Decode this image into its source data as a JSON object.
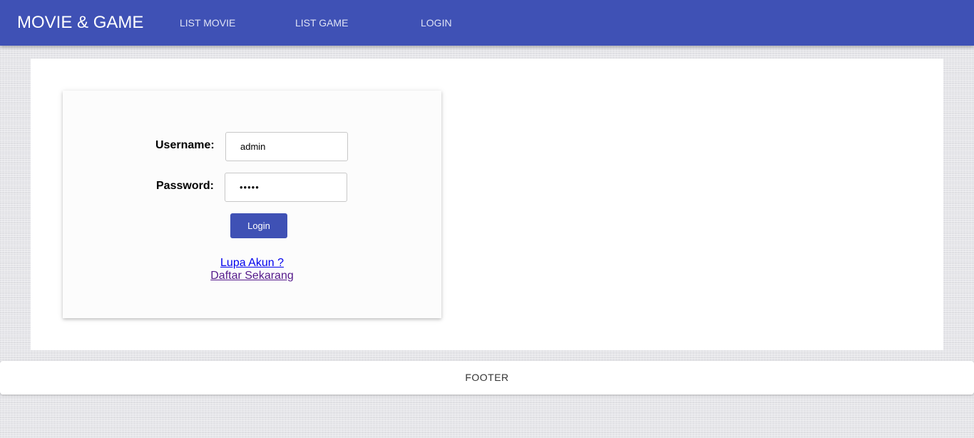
{
  "navbar": {
    "brand": "MOVIE & GAME",
    "links": [
      {
        "label": "LIST MOVIE"
      },
      {
        "label": "LIST GAME"
      },
      {
        "label": "LOGIN"
      }
    ],
    "color": "#3f51b5"
  },
  "login_form": {
    "username_label": "Username:",
    "username_value": "admin",
    "password_label": "Password:",
    "password_value": "admin",
    "submit_label": "Login",
    "forgot_link": "Lupa Akun ?",
    "register_link": "Daftar Sekarang"
  },
  "footer": {
    "text": "FOOTER"
  }
}
